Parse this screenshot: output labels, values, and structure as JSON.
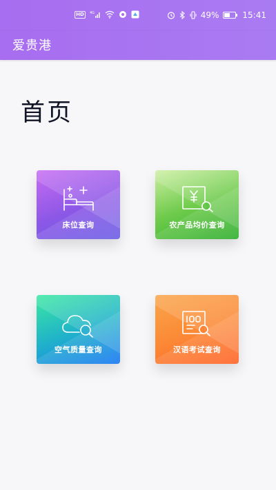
{
  "status_bar": {
    "left_icons": [
      "hd-icon",
      "4g-signal-icon",
      "wifi-icon",
      "location-icon",
      "notification-icon"
    ],
    "alarm_icon": "alarm-icon",
    "bluetooth_icon": "bluetooth-icon",
    "vibrate_icon": "vibrate-icon",
    "battery_percent": "49%",
    "battery_icon": "battery-icon",
    "time": "15:41"
  },
  "app_bar": {
    "title": "爱贵港"
  },
  "page": {
    "title": "首页"
  },
  "tiles": [
    {
      "label": "床位查询",
      "icon": "bed-icon"
    },
    {
      "label": "农产品均价查询",
      "icon": "price-search-icon"
    },
    {
      "label": "空气质量查询",
      "icon": "cloud-search-icon"
    },
    {
      "label": "汉语考试查询",
      "icon": "exam-search-icon"
    }
  ],
  "colors": {
    "app_bar": "#a86df0",
    "page_background": "#f7f7f9",
    "tile_bed": "#8b57e6",
    "tile_agri": "#2fae2d",
    "tile_air": "#1677f3",
    "tile_hsk": "#ff6328"
  }
}
